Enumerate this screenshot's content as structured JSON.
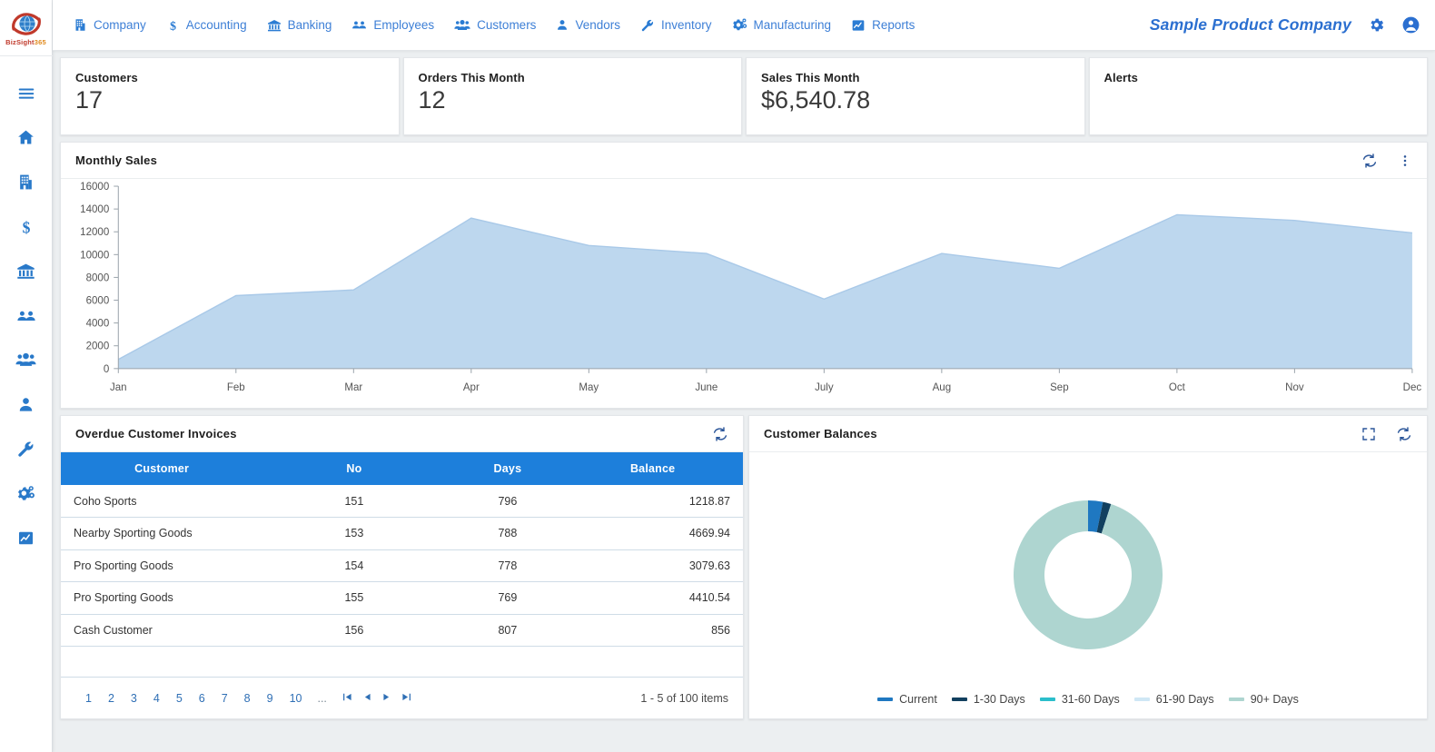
{
  "brand": {
    "logo_biz": "BizSight",
    "logo_num": "365",
    "logo_sight": "Sight",
    "logo_name": "BizSight 365"
  },
  "sidebar": {
    "items": [
      {
        "icon": "hamburger-menu-icon",
        "name": "menu-toggle"
      },
      {
        "icon": "home-icon",
        "name": "sidebar-item-home"
      },
      {
        "icon": "building-icon",
        "name": "sidebar-item-company"
      },
      {
        "icon": "dollar-icon",
        "name": "sidebar-item-accounting"
      },
      {
        "icon": "bank-icon",
        "name": "sidebar-item-banking"
      },
      {
        "icon": "employees-icon",
        "name": "sidebar-item-employees"
      },
      {
        "icon": "customers-icon",
        "name": "sidebar-item-customers"
      },
      {
        "icon": "vendor-person-icon",
        "name": "sidebar-item-vendors"
      },
      {
        "icon": "wrench-icon",
        "name": "sidebar-item-inventory"
      },
      {
        "icon": "gears-icon",
        "name": "sidebar-item-manufacturing"
      },
      {
        "icon": "report-chart-icon",
        "name": "sidebar-item-reports"
      }
    ]
  },
  "topnav": {
    "items": [
      {
        "label": "Company",
        "icon": "building-icon"
      },
      {
        "label": "Accounting",
        "icon": "dollar-icon"
      },
      {
        "label": "Banking",
        "icon": "bank-icon"
      },
      {
        "label": "Employees",
        "icon": "employees-icon"
      },
      {
        "label": "Customers",
        "icon": "customers-icon"
      },
      {
        "label": "Vendors",
        "icon": "person-icon"
      },
      {
        "label": "Inventory",
        "icon": "wrench-icon"
      },
      {
        "label": "Manufacturing",
        "icon": "gears-icon"
      },
      {
        "label": "Reports",
        "icon": "report-chart-icon"
      }
    ],
    "company_name": "Sample Product Company",
    "settings_icon": "gear-icon",
    "account_icon": "account-circle-icon"
  },
  "kpis": [
    {
      "title": "Customers",
      "value": "17"
    },
    {
      "title": "Orders This Month",
      "value": "12"
    },
    {
      "title": "Sales This Month",
      "value": "$6,540.78"
    },
    {
      "title": "Alerts",
      "value": ""
    }
  ],
  "monthly_sales_card": {
    "title": "Monthly Sales",
    "refresh_icon": "refresh-icon",
    "more_icon": "more-vertical-icon"
  },
  "overdue_panel": {
    "title": "Overdue Customer Invoices",
    "refresh_icon": "refresh-icon",
    "columns": [
      "Customer",
      "No",
      "Days",
      "Balance"
    ],
    "rows": [
      {
        "customer": "Coho Sports",
        "no": "151",
        "days": "796",
        "balance": "1218.87"
      },
      {
        "customer": "Nearby Sporting Goods",
        "no": "153",
        "days": "788",
        "balance": "4669.94"
      },
      {
        "customer": "Pro Sporting Goods",
        "no": "154",
        "days": "778",
        "balance": "3079.63"
      },
      {
        "customer": "Pro Sporting Goods",
        "no": "155",
        "days": "769",
        "balance": "4410.54"
      },
      {
        "customer": "Cash Customer",
        "no": "156",
        "days": "807",
        "balance": "856"
      }
    ],
    "pagination": {
      "pages": [
        "1",
        "2",
        "3",
        "4",
        "5",
        "6",
        "7",
        "8",
        "9",
        "10"
      ],
      "ellipsis": "...",
      "first_arrow": "◄|",
      "prev_arrow": "◄",
      "next_arrow": "►",
      "last_arrow": "|►",
      "info": "1 - 5 of 100 items"
    }
  },
  "balances_panel": {
    "title": "Customer Balances",
    "expand_icon": "fullscreen-icon",
    "refresh_icon": "refresh-icon"
  },
  "chart_data": [
    {
      "type": "area",
      "title": "Monthly Sales",
      "xlabel": "",
      "ylabel": "",
      "categories": [
        "Jan",
        "Feb",
        "Mar",
        "Apr",
        "May",
        "June",
        "July",
        "Aug",
        "Sep",
        "Oct",
        "Nov",
        "Dec"
      ],
      "values": [
        800,
        6400,
        6900,
        13200,
        10800,
        10100,
        6100,
        10100,
        8800,
        13500,
        13000,
        11900
      ],
      "ytick_labels": [
        "0",
        "2000",
        "4000",
        "6000",
        "8000",
        "10000",
        "12000",
        "14000",
        "16000"
      ],
      "ylim": [
        0,
        16000
      ],
      "grid": false,
      "legend_position": "none",
      "series_color": "#bdd7ee",
      "line_color": "#a9c9e8"
    },
    {
      "type": "pie",
      "title": "Customer Balances",
      "subtype": "donut",
      "labels": [
        "Current",
        "1-30 Days",
        "31-60 Days",
        "61-90 Days",
        "90+ Days"
      ],
      "values": [
        3.2,
        1.8,
        0,
        0,
        95.0
      ],
      "colors": [
        "#1f78c1",
        "#12405f",
        "#2bbecb",
        "#cfe7f5",
        "#aed5d0"
      ],
      "legend_position": "bottom"
    }
  ]
}
